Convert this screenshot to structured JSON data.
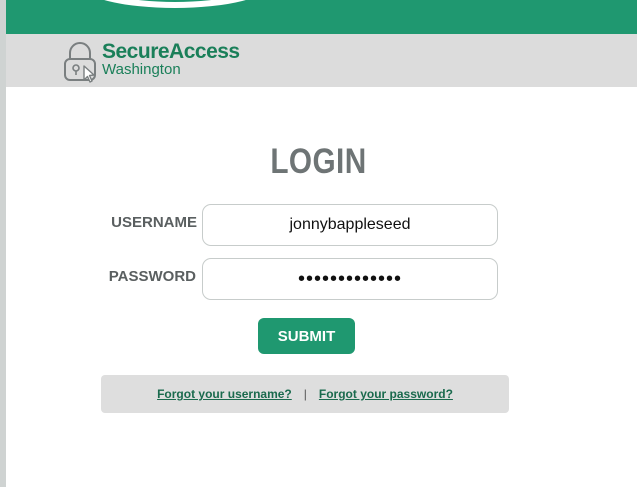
{
  "brand": {
    "title": "SecureAccess",
    "subtitle": "Washington",
    "accent": "#1f9870",
    "text_color": "#1a7f59",
    "icon": "padlock-cursor-icon"
  },
  "login": {
    "heading": "LOGIN",
    "username_label": "USERNAME",
    "username_value": "jonnybappleseed",
    "password_label": "PASSWORD",
    "password_value": "•••••••••••••",
    "submit_label": "SUBMIT"
  },
  "links": {
    "forgot_username": "Forgot your username?",
    "separator": "|",
    "forgot_password": "Forgot your password?"
  }
}
